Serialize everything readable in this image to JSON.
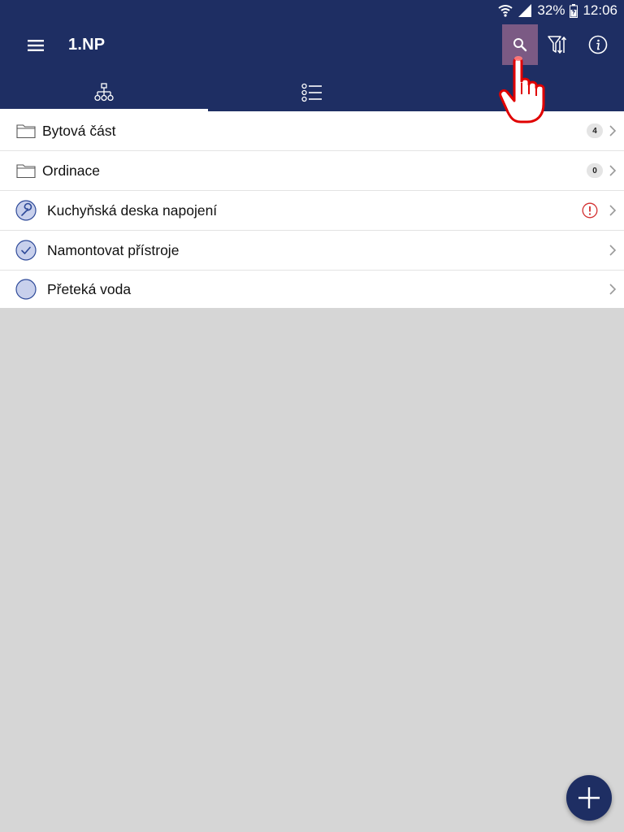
{
  "status_bar": {
    "battery": "32%",
    "time": "12:06"
  },
  "toolbar": {
    "title": "1.NP"
  },
  "icons": {
    "menu": "hamburger-icon",
    "search": "search-icon",
    "filter": "filter-icon",
    "info": "info-icon",
    "tab_tree": "hierarchy-icon",
    "tab_list": "list-icon",
    "fab": "plus-icon"
  },
  "colors": {
    "primary": "#1e2e63",
    "search_highlight": "#7b5a84",
    "task_circle": "#c8d0ec",
    "warning": "#d32f2f",
    "pointer_hand": "#e00000"
  },
  "tabs": [
    {
      "icon": "hierarchy-icon",
      "active": true
    },
    {
      "icon": "list-icon",
      "active": false
    }
  ],
  "items": [
    {
      "type": "folder",
      "label": "Bytová část",
      "count": "4"
    },
    {
      "type": "folder",
      "label": "Ordinace",
      "count": "0"
    },
    {
      "type": "task",
      "status": "in-progress",
      "label": "Kuchyňská deska napojení",
      "warning": true
    },
    {
      "type": "task",
      "status": "done",
      "label": "Namontovat přístroje"
    },
    {
      "type": "task",
      "status": "open",
      "label": "Přeteká voda"
    }
  ]
}
